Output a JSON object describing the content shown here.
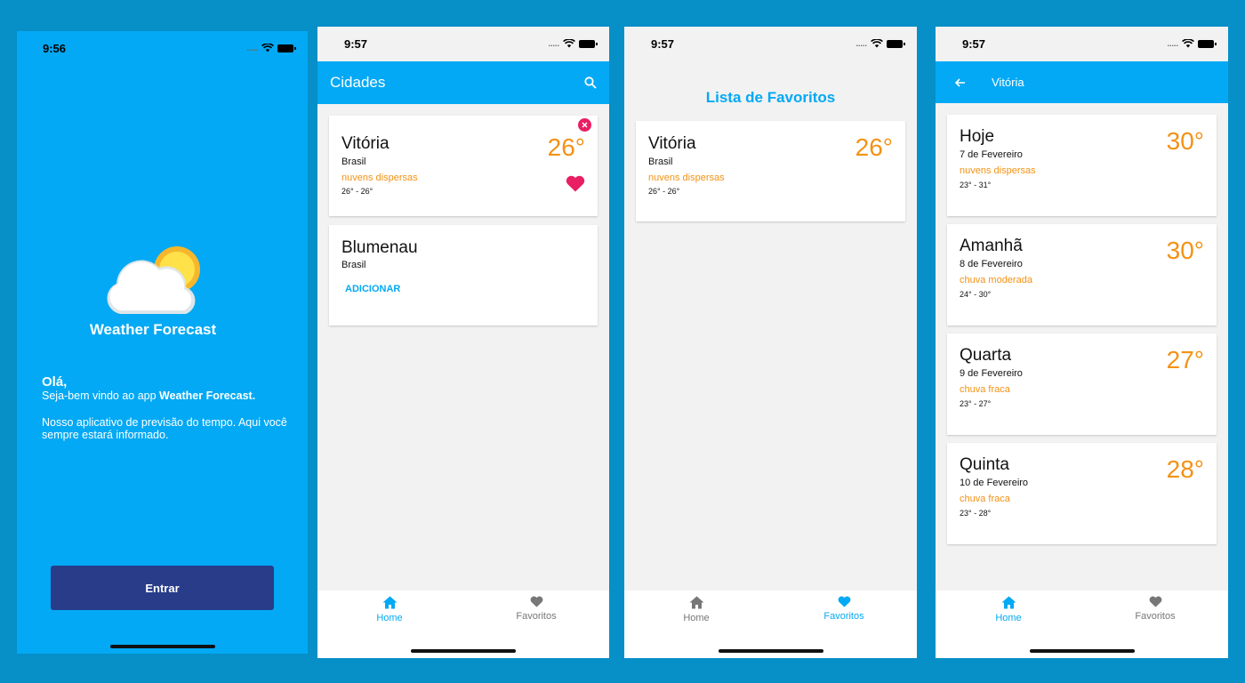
{
  "colors": {
    "primary": "#03a9f4",
    "accent": "#f39214",
    "button": "#283c8a",
    "favorite": "#e91e63"
  },
  "welcome_screen": {
    "time": "9:56",
    "brand": "Weather Forecast",
    "greeting": "Olá,",
    "welcome_line_prefix": "Seja-bem vindo ao app ",
    "welcome_line_bold": "Weather Forecast.",
    "description": "Nosso aplicativo de previsão do tempo. Aqui você sempre estará informado.",
    "enter_label": "Entrar"
  },
  "cities_screen": {
    "time": "9:57",
    "title": "Cidades",
    "cards": [
      {
        "city": "Vitória",
        "country": "Brasil",
        "description": "nuvens dispersas",
        "range": "26° - 26°",
        "temp": "26°"
      },
      {
        "city": "Blumenau",
        "country": "Brasil",
        "add_label": "ADICIONAR"
      }
    ]
  },
  "favorites_screen": {
    "time": "9:57",
    "title": "Lista de Favoritos",
    "card": {
      "city": "Vitória",
      "country": "Brasil",
      "description": "nuvens dispersas",
      "range": "26° - 26°",
      "temp": "26°"
    }
  },
  "detail_screen": {
    "time": "9:57",
    "title": "Vitória",
    "days": [
      {
        "day": "Hoje",
        "date": "7 de Fevereiro",
        "description": "nuvens dispersas",
        "range": "23° - 31°",
        "temp": "30°"
      },
      {
        "day": "Amanhã",
        "date": "8 de Fevereiro",
        "description": "chuva moderada",
        "range": "24° - 30°",
        "temp": "30°"
      },
      {
        "day": "Quarta",
        "date": "9 de Fevereiro",
        "description": "chuva fraca",
        "range": "23° - 27°",
        "temp": "27°"
      },
      {
        "day": "Quinta",
        "date": "10 de Fevereiro",
        "description": "chuva fraca",
        "range": "23° - 28°",
        "temp": "28°"
      }
    ]
  },
  "nav": {
    "home": "Home",
    "favorites": "Favoritos"
  }
}
